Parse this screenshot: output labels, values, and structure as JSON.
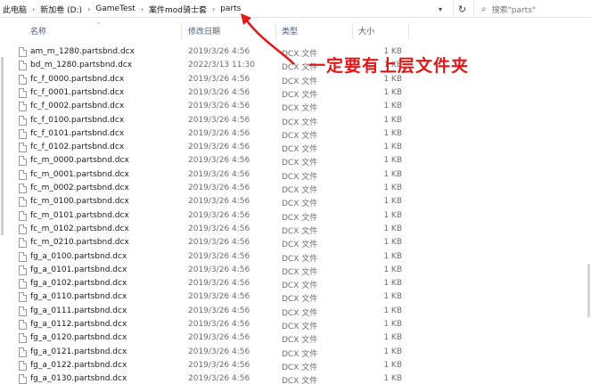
{
  "breadcrumb": {
    "items": [
      "此电脑",
      "新加卷 (D:)",
      "GameTest",
      "案件mod骑士套",
      "parts"
    ],
    "separator": "›"
  },
  "addressbar": {
    "chevron_icon": "chevron-down-icon",
    "refresh_icon": "refresh-icon",
    "refresh_glyph": "↻"
  },
  "search": {
    "placeholder": "搜索\"parts\"",
    "icon": "search-icon"
  },
  "columns": {
    "name": "名称",
    "date": "修改日期",
    "type": "类型",
    "size": "大小"
  },
  "files": [
    {
      "name": "am_m_1280.partsbnd.dcx",
      "date": "2019/3/26 4:56",
      "type": "DCX 文件",
      "size": "1 KB"
    },
    {
      "name": "bd_m_1280.partsbnd.dcx",
      "date": "2022/3/13 11:30",
      "type": "DCX 文件",
      "size": "1 KB"
    },
    {
      "name": "fc_f_0000.partsbnd.dcx",
      "date": "2019/3/26 4:56",
      "type": "DCX 文件",
      "size": "1 KB"
    },
    {
      "name": "fc_f_0001.partsbnd.dcx",
      "date": "2019/3/26 4:56",
      "type": "DCX 文件",
      "size": "1 KB"
    },
    {
      "name": "fc_f_0002.partsbnd.dcx",
      "date": "2019/3/26 4:56",
      "type": "DCX 文件",
      "size": "1 KB"
    },
    {
      "name": "fc_f_0100.partsbnd.dcx",
      "date": "2019/3/26 4:56",
      "type": "DCX 文件",
      "size": "1 KB"
    },
    {
      "name": "fc_f_0101.partsbnd.dcx",
      "date": "2019/3/26 4:56",
      "type": "DCX 文件",
      "size": "1 KB"
    },
    {
      "name": "fc_f_0102.partsbnd.dcx",
      "date": "2019/3/26 4:56",
      "type": "DCX 文件",
      "size": "1 KB"
    },
    {
      "name": "fc_m_0000.partsbnd.dcx",
      "date": "2019/3/26 4:56",
      "type": "DCX 文件",
      "size": "1 KB"
    },
    {
      "name": "fc_m_0001.partsbnd.dcx",
      "date": "2019/3/26 4:56",
      "type": "DCX 文件",
      "size": "1 KB"
    },
    {
      "name": "fc_m_0002.partsbnd.dcx",
      "date": "2019/3/26 4:56",
      "type": "DCX 文件",
      "size": "1 KB"
    },
    {
      "name": "fc_m_0100.partsbnd.dcx",
      "date": "2019/3/26 4:56",
      "type": "DCX 文件",
      "size": "1 KB"
    },
    {
      "name": "fc_m_0101.partsbnd.dcx",
      "date": "2019/3/26 4:56",
      "type": "DCX 文件",
      "size": "1 KB"
    },
    {
      "name": "fc_m_0102.partsbnd.dcx",
      "date": "2019/3/26 4:56",
      "type": "DCX 文件",
      "size": "1 KB"
    },
    {
      "name": "fc_m_0210.partsbnd.dcx",
      "date": "2019/3/26 4:56",
      "type": "DCX 文件",
      "size": "1 KB"
    },
    {
      "name": "fg_a_0100.partsbnd.dcx",
      "date": "2019/3/26 4:56",
      "type": "DCX 文件",
      "size": "1 KB"
    },
    {
      "name": "fg_a_0101.partsbnd.dcx",
      "date": "2019/3/26 4:56",
      "type": "DCX 文件",
      "size": "1 KB"
    },
    {
      "name": "fg_a_0102.partsbnd.dcx",
      "date": "2019/3/26 4:56",
      "type": "DCX 文件",
      "size": "1 KB"
    },
    {
      "name": "fg_a_0110.partsbnd.dcx",
      "date": "2019/3/26 4:56",
      "type": "DCX 文件",
      "size": "1 KB"
    },
    {
      "name": "fg_a_0111.partsbnd.dcx",
      "date": "2019/3/26 4:56",
      "type": "DCX 文件",
      "size": "1 KB"
    },
    {
      "name": "fg_a_0112.partsbnd.dcx",
      "date": "2019/3/26 4:56",
      "type": "DCX 文件",
      "size": "1 KB"
    },
    {
      "name": "fg_a_0120.partsbnd.dcx",
      "date": "2019/3/26 4:56",
      "type": "DCX 文件",
      "size": "1 KB"
    },
    {
      "name": "fg_a_0121.partsbnd.dcx",
      "date": "2019/3/26 4:56",
      "type": "DCX 文件",
      "size": "1 KB"
    },
    {
      "name": "fg_a_0122.partsbnd.dcx",
      "date": "2019/3/26 4:56",
      "type": "DCX 文件",
      "size": "1 KB"
    },
    {
      "name": "fg_a_0130.partsbnd.dcx",
      "date": "2019/3/26 4:56",
      "type": "DCX 文件",
      "size": "1 KB"
    }
  ],
  "annotation": {
    "text": "一定要有上层文件夹",
    "color": "#e01818"
  },
  "colors": {
    "header_text": "#4a5a78",
    "muted_text": "#6d6d6d",
    "file_icon_border": "#9a9a9a"
  }
}
